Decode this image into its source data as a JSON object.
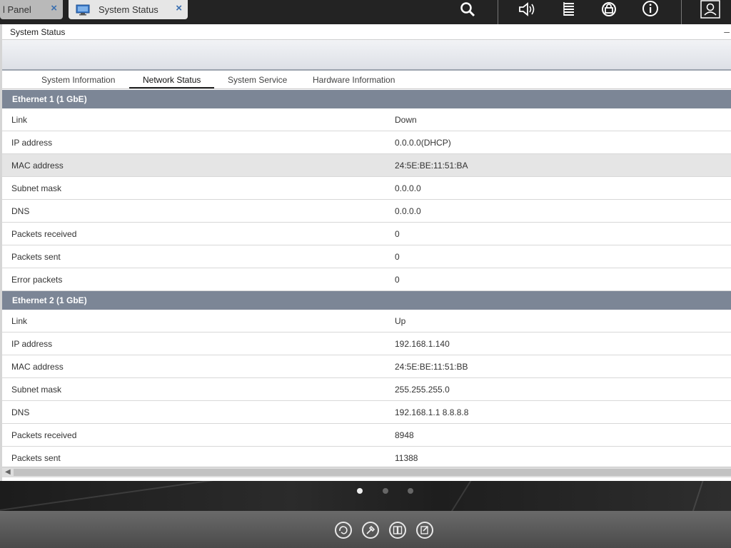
{
  "topbar": {
    "inactive_tab_label": "l Panel",
    "active_tab_label": "System Status",
    "close_glyph": "×",
    "icons": [
      "search-icon",
      "volume-icon",
      "tasks-icon",
      "sync-icon",
      "info-icon",
      "user-icon"
    ]
  },
  "window": {
    "title": "System Status",
    "minimize_glyph": "–"
  },
  "tabs": [
    {
      "label": "System Information"
    },
    {
      "label": "Network Status"
    },
    {
      "label": "System Service"
    },
    {
      "label": "Hardware Information"
    }
  ],
  "active_tab": "Network Status",
  "sections": [
    {
      "title": "Ethernet 1 (1 GbE)",
      "rows": [
        {
          "key": "Link",
          "value": "Down"
        },
        {
          "key": "IP address",
          "value": "0.0.0.0(DHCP)"
        },
        {
          "key": "MAC address",
          "value": "24:5E:BE:11:51:BA"
        },
        {
          "key": "Subnet mask",
          "value": "0.0.0.0"
        },
        {
          "key": "DNS",
          "value": "0.0.0.0"
        },
        {
          "key": "Packets received",
          "value": "0"
        },
        {
          "key": "Packets sent",
          "value": "0"
        },
        {
          "key": "Error packets",
          "value": "0"
        }
      ]
    },
    {
      "title": "Ethernet 2 (1 GbE)",
      "rows": [
        {
          "key": "Link",
          "value": "Up"
        },
        {
          "key": "IP address",
          "value": "192.168.1.140"
        },
        {
          "key": "MAC address",
          "value": "24:5E:BE:11:51:BB"
        },
        {
          "key": "Subnet mask",
          "value": "255.255.255.0"
        },
        {
          "key": "DNS",
          "value": "192.168.1.1 8.8.8.8"
        },
        {
          "key": "Packets received",
          "value": "8948"
        },
        {
          "key": "Packets sent",
          "value": "11388"
        }
      ]
    }
  ],
  "highlighted_row": "MAC address",
  "desktop": {
    "page_dots": 3,
    "active_dot": 1,
    "dock_icons": [
      "qsync-icon",
      "tools-icon",
      "book-icon",
      "notes-icon"
    ]
  },
  "colors": {
    "section_header": "#7c8696",
    "close_accent": "#3a6fb0",
    "highlight_row": "#e5e5e5"
  }
}
